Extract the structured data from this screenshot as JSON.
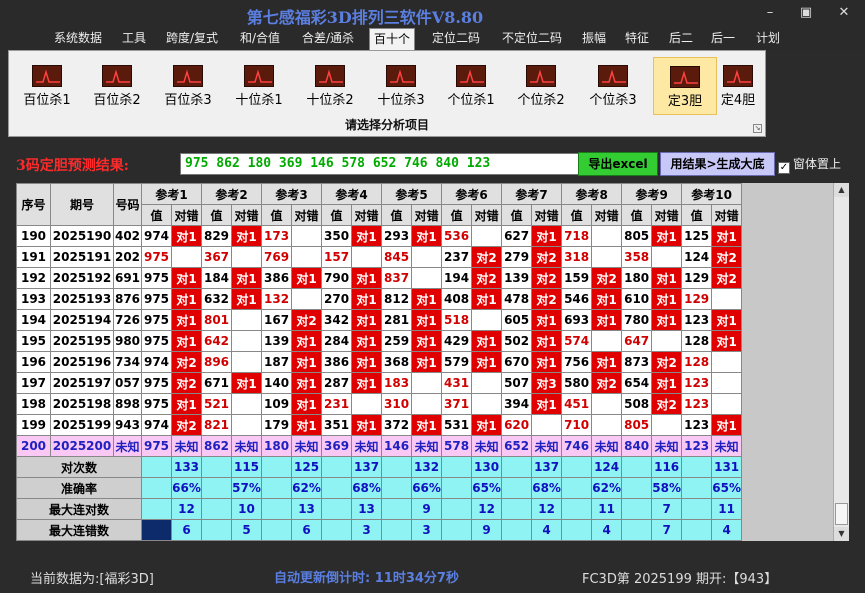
{
  "window": {
    "title": "第七感福彩3D排列三软件V8.80",
    "minimize": "–",
    "maximize": "▣",
    "close": "✕"
  },
  "menu": [
    "系统数据",
    "工具",
    "跨度/复式",
    "和/合值",
    "合差/通杀",
    "百十个",
    "定位二码",
    "不定位二码",
    "振幅",
    "特征",
    "后二",
    "后一",
    "计划"
  ],
  "menu_active": 5,
  "ribbon": {
    "buttons": [
      "百位杀1",
      "百位杀2",
      "百位杀3",
      "十位杀1",
      "十位杀2",
      "十位杀3",
      "个位杀1",
      "个位杀2",
      "个位杀3",
      "定3胆",
      "定4胆"
    ],
    "active": 9,
    "caption": "请选择分析项目"
  },
  "prediction": {
    "label": "3码定胆预测结果:",
    "value": "975 862 180 369 146 578 652 746 840 123",
    "export_button": "导出excel",
    "generate_button": "用结果>生成大底",
    "topmost_label": "窗体置上",
    "topmost_checked": "✓"
  },
  "grid": {
    "fixed_headers": [
      "序号",
      "期号",
      "号码"
    ],
    "ref_headers": [
      "参考1",
      "参考2",
      "参考3",
      "参考4",
      "参考5",
      "参考6",
      "参考7",
      "参考8",
      "参考9",
      "参考10"
    ],
    "sub_headers": [
      "值",
      "对错"
    ],
    "rows": [
      {
        "seq": "190",
        "issue": "2025190",
        "num": "402",
        "refs": [
          [
            "974",
            "对1"
          ],
          [
            "829",
            "对1"
          ],
          [
            "173",
            ""
          ],
          [
            "350",
            "对1"
          ],
          [
            "293",
            "对1"
          ],
          [
            "536",
            ""
          ],
          [
            "627",
            "对1"
          ],
          [
            "718",
            ""
          ],
          [
            "805",
            "对1"
          ],
          [
            "125",
            "对1"
          ]
        ]
      },
      {
        "seq": "191",
        "issue": "2025191",
        "num": "202",
        "refs": [
          [
            "975",
            ""
          ],
          [
            "367",
            ""
          ],
          [
            "769",
            ""
          ],
          [
            "157",
            ""
          ],
          [
            "845",
            ""
          ],
          [
            "237",
            "对2"
          ],
          [
            "279",
            "对2"
          ],
          [
            "318",
            ""
          ],
          [
            "358",
            ""
          ],
          [
            "124",
            "对2"
          ]
        ]
      },
      {
        "seq": "192",
        "issue": "2025192",
        "num": "691",
        "refs": [
          [
            "975",
            "对1"
          ],
          [
            "184",
            "对1"
          ],
          [
            "386",
            "对1"
          ],
          [
            "790",
            "对1"
          ],
          [
            "837",
            ""
          ],
          [
            "194",
            "对2"
          ],
          [
            "139",
            "对2"
          ],
          [
            "159",
            "对2"
          ],
          [
            "180",
            "对1"
          ],
          [
            "129",
            "对2"
          ]
        ]
      },
      {
        "seq": "193",
        "issue": "2025193",
        "num": "876",
        "refs": [
          [
            "975",
            "对1"
          ],
          [
            "632",
            "对1"
          ],
          [
            "132",
            ""
          ],
          [
            "270",
            "对1"
          ],
          [
            "812",
            "对1"
          ],
          [
            "408",
            "对1"
          ],
          [
            "478",
            "对2"
          ],
          [
            "546",
            "对1"
          ],
          [
            "610",
            "对1"
          ],
          [
            "129",
            ""
          ]
        ]
      },
      {
        "seq": "194",
        "issue": "2025194",
        "num": "726",
        "refs": [
          [
            "975",
            "对1"
          ],
          [
            "801",
            ""
          ],
          [
            "167",
            "对2"
          ],
          [
            "342",
            "对1"
          ],
          [
            "281",
            "对1"
          ],
          [
            "518",
            ""
          ],
          [
            "605",
            "对1"
          ],
          [
            "693",
            "对1"
          ],
          [
            "780",
            "对1"
          ],
          [
            "123",
            "对1"
          ]
        ]
      },
      {
        "seq": "195",
        "issue": "2025195",
        "num": "980",
        "refs": [
          [
            "975",
            "对1"
          ],
          [
            "642",
            ""
          ],
          [
            "139",
            "对1"
          ],
          [
            "284",
            "对1"
          ],
          [
            "259",
            "对1"
          ],
          [
            "429",
            "对1"
          ],
          [
            "502",
            "对1"
          ],
          [
            "574",
            ""
          ],
          [
            "647",
            ""
          ],
          [
            "128",
            "对1"
          ]
        ]
      },
      {
        "seq": "196",
        "issue": "2025196",
        "num": "734",
        "refs": [
          [
            "974",
            "对2"
          ],
          [
            "896",
            ""
          ],
          [
            "187",
            "对1"
          ],
          [
            "386",
            "对1"
          ],
          [
            "368",
            "对1"
          ],
          [
            "579",
            "对1"
          ],
          [
            "670",
            "对1"
          ],
          [
            "756",
            "对1"
          ],
          [
            "873",
            "对2"
          ],
          [
            "128",
            ""
          ]
        ]
      },
      {
        "seq": "197",
        "issue": "2025197",
        "num": "057",
        "refs": [
          [
            "975",
            "对2"
          ],
          [
            "671",
            "对1"
          ],
          [
            "140",
            "对1"
          ],
          [
            "287",
            "对1"
          ],
          [
            "183",
            ""
          ],
          [
            "431",
            ""
          ],
          [
            "507",
            "对3"
          ],
          [
            "580",
            "对2"
          ],
          [
            "654",
            "对1"
          ],
          [
            "123",
            ""
          ]
        ]
      },
      {
        "seq": "198",
        "issue": "2025198",
        "num": "898",
        "refs": [
          [
            "975",
            "对1"
          ],
          [
            "521",
            ""
          ],
          [
            "109",
            "对1"
          ],
          [
            "231",
            ""
          ],
          [
            "310",
            ""
          ],
          [
            "371",
            ""
          ],
          [
            "394",
            "对1"
          ],
          [
            "451",
            ""
          ],
          [
            "508",
            "对2"
          ],
          [
            "123",
            ""
          ]
        ]
      },
      {
        "seq": "199",
        "issue": "2025199",
        "num": "943",
        "refs": [
          [
            "974",
            "对2"
          ],
          [
            "821",
            ""
          ],
          [
            "179",
            "对1"
          ],
          [
            "351",
            "对1"
          ],
          [
            "372",
            "对1"
          ],
          [
            "531",
            "对1"
          ],
          [
            "620",
            ""
          ],
          [
            "710",
            ""
          ],
          [
            "805",
            ""
          ],
          [
            "123",
            "对1"
          ]
        ]
      }
    ],
    "pending": {
      "seq": "200",
      "issue": "2025200",
      "num": "未知",
      "values": [
        "975",
        "862",
        "180",
        "369",
        "146",
        "578",
        "652",
        "746",
        "840",
        "123"
      ],
      "mark": "未知"
    },
    "stats": [
      {
        "label": "对次数",
        "values": [
          "133",
          "115",
          "125",
          "137",
          "132",
          "130",
          "137",
          "124",
          "116",
          "131"
        ]
      },
      {
        "label": "准确率",
        "values": [
          "66%",
          "57%",
          "62%",
          "68%",
          "66%",
          "65%",
          "68%",
          "62%",
          "58%",
          "65%"
        ]
      },
      {
        "label": "最大连对数",
        "values": [
          "12",
          "10",
          "13",
          "13",
          "9",
          "12",
          "12",
          "11",
          "7",
          "11"
        ]
      },
      {
        "label": "最大连错数",
        "values": [
          "6",
          "5",
          "6",
          "3",
          "3",
          "9",
          "4",
          "4",
          "7",
          "4"
        ]
      }
    ],
    "scroll_up": "▲",
    "scroll_down": "▼"
  },
  "status": {
    "current_data": "当前数据为:[福彩3D]",
    "countdown": "自动更新倒计时:  11时34分7秒",
    "issue_info": "FC3D第 2025199 期开:【943】"
  }
}
